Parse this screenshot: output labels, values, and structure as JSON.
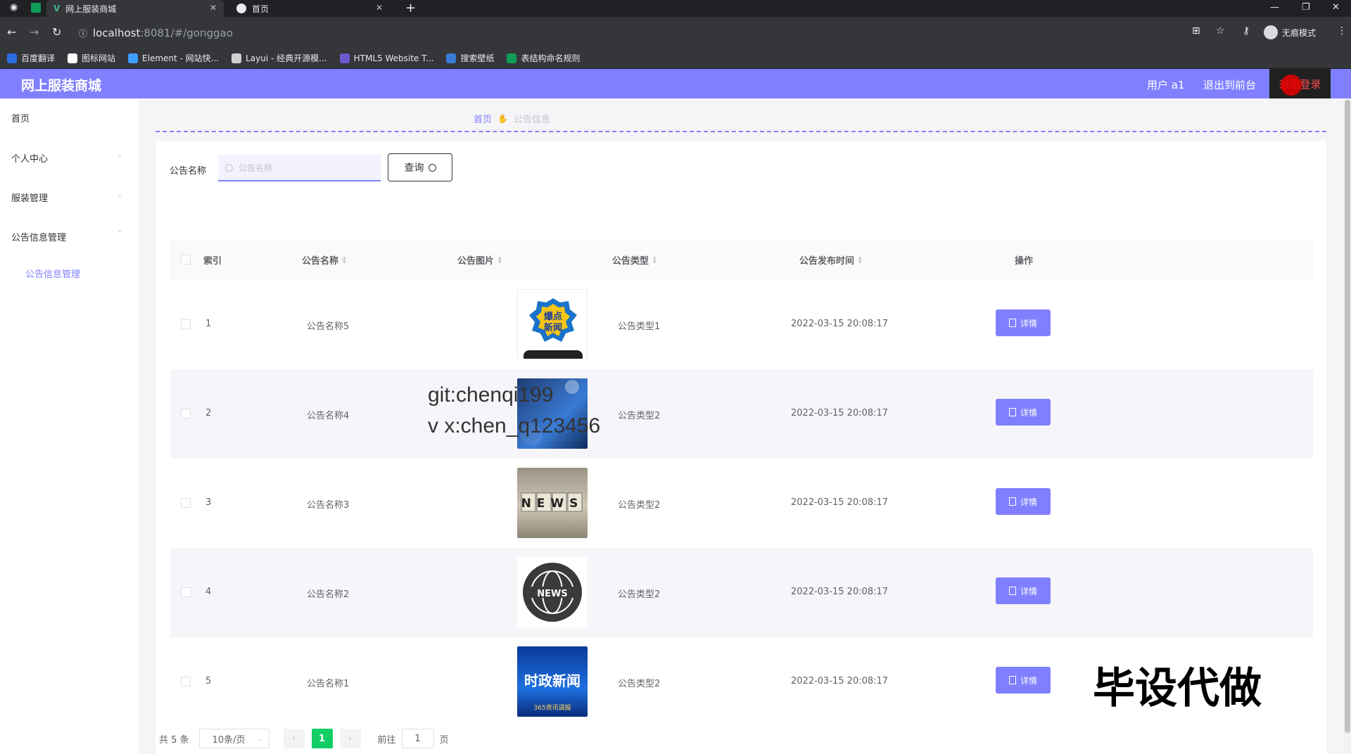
{
  "browser": {
    "tabs": [
      {
        "label": "网上服装商城"
      },
      {
        "label": "首页"
      }
    ],
    "url_host": "localhost",
    "url_path": ":8081/#/gonggao",
    "incognito_label": "无痕模式",
    "bookmarks": [
      {
        "label": "百度翻译",
        "color": "#2b6de0"
      },
      {
        "label": "图标网站",
        "color": "#ffffff"
      },
      {
        "label": "Element - 网站快...",
        "color": "#409eff"
      },
      {
        "label": "Layui - 经典开源模...",
        "color": "#d0d0d0"
      },
      {
        "label": "HTML5 Website T...",
        "color": "#6a5acd"
      },
      {
        "label": "搜索壁纸",
        "color": "#3a7bd5"
      },
      {
        "label": "表结构命名规则",
        "color": "#0f9d58"
      }
    ]
  },
  "header": {
    "brand": "网上服装商城",
    "user": "用户 a1",
    "to_front": "退出到前台",
    "logout": "退出登录",
    "accent": "#8080ff"
  },
  "sidebar": {
    "items": [
      {
        "label": "首页"
      },
      {
        "label": "个人中心"
      },
      {
        "label": "服装管理"
      },
      {
        "label": "公告信息管理"
      }
    ],
    "sub_active": "公告信息管理"
  },
  "breadcrumb": {
    "home": "首页",
    "current": "公告信息"
  },
  "search": {
    "label": "公告名称",
    "placeholder": "公告名称",
    "button": "查询"
  },
  "table": {
    "headers": {
      "index": "索引",
      "name": "公告名称",
      "image": "公告图片",
      "type": "公告类型",
      "time": "公告发布时间",
      "action": "操作"
    },
    "rows": [
      {
        "index": "1",
        "name": "公告名称5",
        "type": "公告类型1",
        "time": "2022-03-15 20:08:17",
        "image_text": "爆点\n新闻",
        "action": "详情"
      },
      {
        "index": "2",
        "name": "公告名称4",
        "type": "公告类型2",
        "time": "2022-03-15 20:08:17",
        "image_text": "",
        "action": "详情"
      },
      {
        "index": "3",
        "name": "公告名称3",
        "type": "公告类型2",
        "time": "2022-03-15 20:08:17",
        "image_text": "NEWS",
        "action": "详情"
      },
      {
        "index": "4",
        "name": "公告名称2",
        "type": "公告类型2",
        "time": "2022-03-15 20:08:17",
        "image_text": "NEWS",
        "action": "详情"
      },
      {
        "index": "5",
        "name": "公告名称1",
        "type": "公告类型2",
        "time": "2022-03-15 20:08:17",
        "image_text": "时政新闻",
        "image_subtext": "365资讯调报",
        "action": "详情"
      }
    ]
  },
  "pagination": {
    "total": "共 5 条",
    "page_size": "10条/页",
    "current_page": "1",
    "goto_label": "前往",
    "goto_value": "1",
    "page_unit": "页"
  },
  "watermarks": {
    "line1": "git:chenqi199",
    "line2": "v x:chen_q123456",
    "big": "毕设代做"
  }
}
